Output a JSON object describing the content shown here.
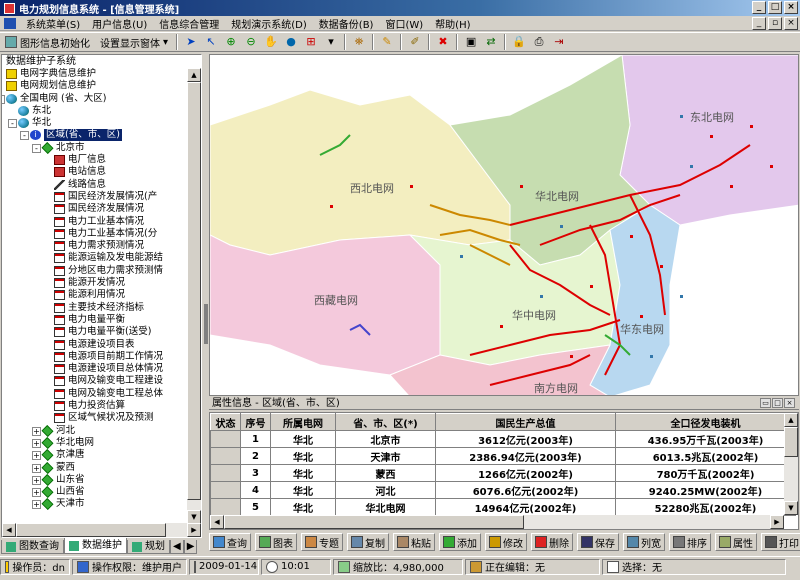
{
  "window": {
    "title": "电力规划信息系统 - [信息管理系统]"
  },
  "menu": [
    "系统菜单(S)",
    "用户信息(U)",
    "信息综合管理",
    "规划演示系统(D)",
    "数据备份(B)",
    "窗口(W)",
    "帮助(H)"
  ],
  "toolbar": {
    "init_label": "图形信息初始化",
    "display_label": "设置显示窗体"
  },
  "left_panel": {
    "title": "数据维护子系统",
    "tree": [
      {
        "level": 0,
        "icon": "book",
        "label": "电网字典信息维护"
      },
      {
        "level": 0,
        "icon": "book",
        "label": "电网规划信息维护"
      },
      {
        "level": 0,
        "icon": "globe",
        "toggle": "-",
        "label": "全国电网 (省、大区)"
      },
      {
        "level": 1,
        "icon": "globe",
        "label": "东北"
      },
      {
        "level": 1,
        "icon": "globe",
        "toggle": "-",
        "label": "华北"
      },
      {
        "level": 2,
        "icon": "info",
        "toggle": "-",
        "label": "区域(省、市、区)",
        "selected": true
      },
      {
        "level": 3,
        "icon": "diamond",
        "toggle": "-",
        "label": "北京市"
      },
      {
        "level": 4,
        "icon": "red",
        "label": "电厂信息"
      },
      {
        "level": 4,
        "icon": "red",
        "label": "电站信息"
      },
      {
        "level": 4,
        "icon": "tower",
        "label": "线路信息"
      },
      {
        "level": 4,
        "icon": "doc",
        "label": "国民经济发展情况(产"
      },
      {
        "level": 4,
        "icon": "doc",
        "label": "国民经济发展情况"
      },
      {
        "level": 4,
        "icon": "doc",
        "label": "电力工业基本情况"
      },
      {
        "level": 4,
        "icon": "doc",
        "label": "电力工业基本情况(分"
      },
      {
        "level": 4,
        "icon": "doc",
        "label": "电力需求预测情况"
      },
      {
        "level": 4,
        "icon": "doc",
        "label": "能源运输及发电能源结"
      },
      {
        "level": 4,
        "icon": "doc",
        "label": "分地区电力需求预测情"
      },
      {
        "level": 4,
        "icon": "doc",
        "label": "能源开发情况"
      },
      {
        "level": 4,
        "icon": "doc",
        "label": "能源利用情况"
      },
      {
        "level": 4,
        "icon": "doc",
        "label": "主要技术经济指标"
      },
      {
        "level": 4,
        "icon": "doc",
        "label": "电力电量平衡"
      },
      {
        "level": 4,
        "icon": "doc",
        "label": "电力电量平衡(送受)"
      },
      {
        "level": 4,
        "icon": "doc",
        "label": "电源建设项目表"
      },
      {
        "level": 4,
        "icon": "doc",
        "label": "电源项目前期工作情况"
      },
      {
        "level": 4,
        "icon": "doc",
        "label": "电源建设项目总体情况"
      },
      {
        "level": 4,
        "icon": "doc",
        "label": "电网及输变电工程建设"
      },
      {
        "level": 4,
        "icon": "doc",
        "label": "电网及输变电工程总体"
      },
      {
        "level": 4,
        "icon": "doc",
        "label": "电力投资估算"
      },
      {
        "level": 4,
        "icon": "doc",
        "label": "区域气候状况及预测"
      },
      {
        "level": 3,
        "icon": "diamond",
        "toggle": "+",
        "label": "河北"
      },
      {
        "level": 3,
        "icon": "diamond",
        "toggle": "+",
        "label": "华北电网"
      },
      {
        "level": 3,
        "icon": "diamond",
        "toggle": "+",
        "label": "京津唐"
      },
      {
        "level": 3,
        "icon": "diamond",
        "toggle": "+",
        "label": "蒙西"
      },
      {
        "level": 3,
        "icon": "diamond",
        "toggle": "+",
        "label": "山东省"
      },
      {
        "level": 3,
        "icon": "diamond",
        "toggle": "+",
        "label": "山西省"
      },
      {
        "level": 3,
        "icon": "diamond",
        "toggle": "+",
        "label": "天津市"
      }
    ],
    "tabs": [
      "图数查询",
      "数据维护",
      "规划"
    ]
  },
  "map": {
    "labels": [
      "东北电网",
      "西北电网",
      "华北电网",
      "西藏电网",
      "华中电网",
      "华东电网",
      "南方电网"
    ],
    "colors": {
      "northeast": "#e3c8ec",
      "northwest": "#f3eec0",
      "north": "#c6ddb0",
      "tibet": "#f4c9dc",
      "central": "#e6f5d0",
      "east": "#b8d8f0",
      "south": "#f3c3cf",
      "background": "#ffffff"
    }
  },
  "info": {
    "title": "属性信息 - 区域(省、市、区)",
    "columns": [
      "状态",
      "序号",
      "所属电网",
      "省、市、区(*)",
      "国民生产总值",
      "全口径发电装机"
    ],
    "rows": [
      [
        "",
        "1",
        "华北",
        "北京市",
        "3612亿元(2003年)",
        "436.95万千瓦(2003年)"
      ],
      [
        "",
        "2",
        "华北",
        "天津市",
        "2386.94亿元(2003年)",
        "6013.5兆瓦(2002年)"
      ],
      [
        "",
        "3",
        "华北",
        "蒙西",
        "1266亿元(2002年)",
        "780万千瓦(2002年)"
      ],
      [
        "",
        "4",
        "华北",
        "河北",
        "6076.6亿元(2002年)",
        "9240.25MW(2002年)"
      ],
      [
        "",
        "5",
        "华北",
        "华北电网",
        "14964亿元(2002年)",
        "52280兆瓦(2002年)"
      ]
    ]
  },
  "actions": [
    "查询",
    "图表",
    "专题",
    "复制",
    "粘贴",
    "添加",
    "修改",
    "删除",
    "保存",
    "列宽",
    "排序",
    "属性",
    "打印"
  ],
  "status": {
    "operator": "操作员：dn",
    "permission": "操作权限：维护用户",
    "date": "2009-01-14",
    "time": "10:01",
    "zoom": "缩放比：4,980,000",
    "editing": "正在编辑：无",
    "selection": "选择：无"
  }
}
